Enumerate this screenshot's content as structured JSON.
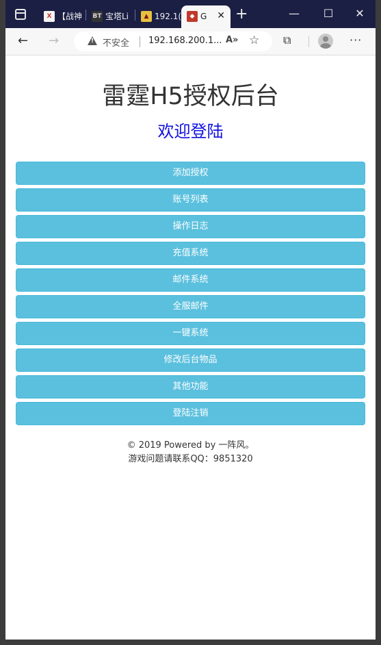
{
  "browser": {
    "tabs": [
      {
        "favicon": "X",
        "title": "【战神"
      },
      {
        "favicon": "BT",
        "title": "宝塔Li"
      },
      {
        "favicon": "",
        "title": "192.1("
      },
      {
        "favicon": "",
        "title": "G"
      }
    ],
    "new_tab": "+",
    "insecure_label": "不安全",
    "url": "192.168.200.1...",
    "read_aloud": "Aͅ"
  },
  "page": {
    "title": "雷霆H5授权后台",
    "welcome": "欢迎登陆",
    "menu": [
      {
        "label": "添加授权"
      },
      {
        "label": "账号列表"
      },
      {
        "label": "操作日志"
      },
      {
        "label": "充值系统"
      },
      {
        "label": "邮件系统"
      },
      {
        "label": "全服邮件"
      },
      {
        "label": "一键系统"
      },
      {
        "label": "修改后台物品"
      },
      {
        "label": "其他功能"
      },
      {
        "label": "登陆注销"
      }
    ],
    "footer_line1": "© 2019 Powered by 一阵风。",
    "footer_line2": "游戏问题请联系QQ：9851320"
  },
  "colors": {
    "button_bg": "#5bc0de",
    "welcome_text": "#1010e0",
    "tabstrip": "#1b1f44"
  }
}
